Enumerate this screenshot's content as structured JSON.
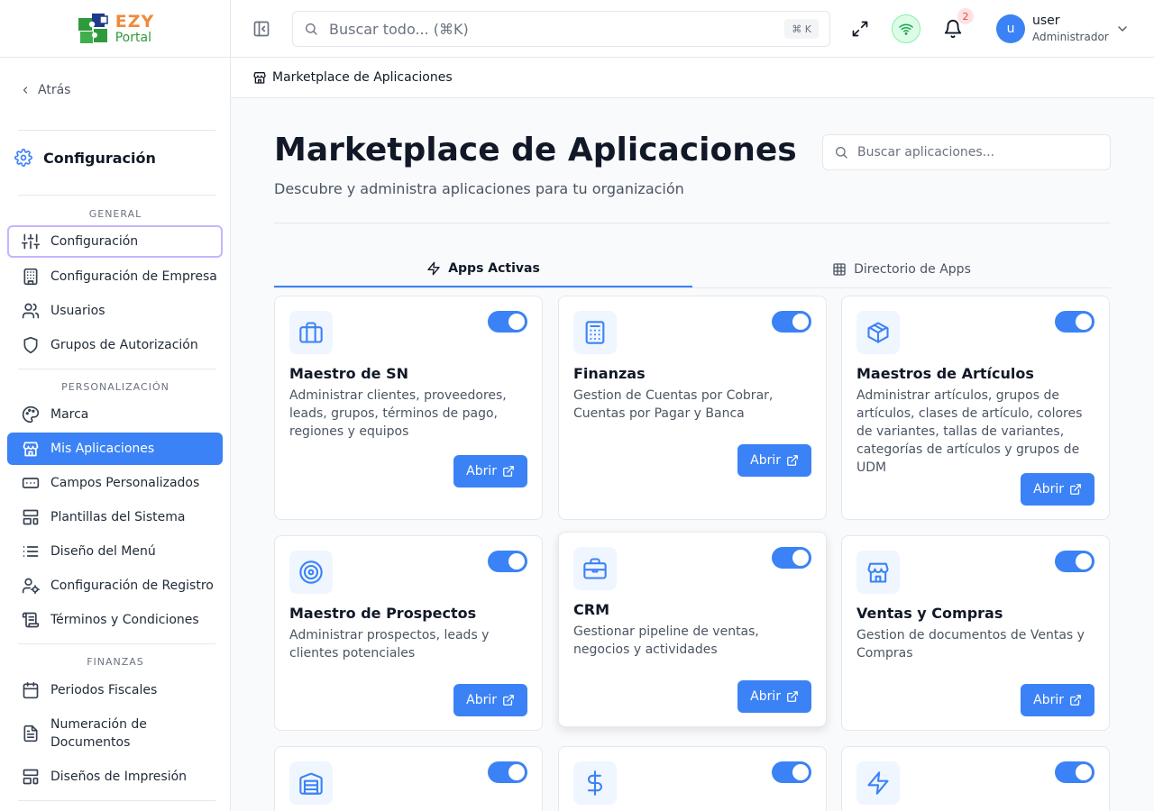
{
  "brand": {
    "line1": "EZY",
    "line2": "Portal"
  },
  "sidebar": {
    "back_label": "Atrás",
    "section_title": "Configuración",
    "groups": {
      "general": "GENERAL",
      "personalizacion": "PERSONALIZACIÓN",
      "finanzas": "FINANZAS"
    },
    "items": [
      {
        "label": "Configuración",
        "icon": "sliders-icon"
      },
      {
        "label": "Configuración de Empresa",
        "icon": "building-icon"
      },
      {
        "label": "Usuarios",
        "icon": "users-icon"
      },
      {
        "label": "Grupos de Autorización",
        "icon": "shield-icon"
      },
      {
        "label": "Marca",
        "icon": "palette-icon"
      },
      {
        "label": "Mis Aplicaciones",
        "icon": "store-icon"
      },
      {
        "label": "Campos Personalizados",
        "icon": "form-field-icon"
      },
      {
        "label": "Plantillas del Sistema",
        "icon": "layout-template-icon"
      },
      {
        "label": "Diseño del Menú",
        "icon": "list-icon"
      },
      {
        "label": "Configuración de Registro",
        "icon": "user-cog-icon"
      },
      {
        "label": "Términos y Condiciones",
        "icon": "scroll-icon"
      },
      {
        "label": "Periodos Fiscales",
        "icon": "calendar-icon"
      },
      {
        "label": "Numeración de Documentos",
        "icon": "file-text-icon"
      },
      {
        "label": "Diseños de Impresión",
        "icon": "layout-template-icon"
      }
    ]
  },
  "topbar": {
    "search_placeholder": "Buscar todo... (⌘K)",
    "shortcut": "⌘ K",
    "notifications_count": "2",
    "user_initial": "u",
    "user_name": "user",
    "user_role": "Administrador"
  },
  "breadcrumb": {
    "label": "Marketplace de Aplicaciones"
  },
  "main": {
    "title": "Marketplace de Aplicaciones",
    "subtitle": "Descubre y administra aplicaciones para tu organización",
    "search_placeholder": "Buscar aplicaciones...",
    "tabs": [
      {
        "label": "Apps Activas",
        "icon": "zap-icon"
      },
      {
        "label": "Directorio de Apps",
        "icon": "grid-icon"
      }
    ],
    "open_label": "Abrir",
    "apps": [
      {
        "title": "Maestro de SN",
        "desc": "Administrar clientes, proveedores, leads, grupos, términos de pago, regiones y equipos",
        "icon": "briefcase-icon",
        "enabled": true
      },
      {
        "title": "Finanzas",
        "desc": "Gestion de Cuentas por Cobrar, Cuentas por Pagar y Banca",
        "icon": "calculator-icon",
        "enabled": true
      },
      {
        "title": "Maestros de Artículos",
        "desc": "Administrar artículos, grupos de artículos, clases de artículo, colores de variantes, tallas de variantes, categorías de artículos y grupos de UDM",
        "icon": "package-icon",
        "enabled": true
      },
      {
        "title": "Maestro de Prospectos",
        "desc": "Administrar prospectos, leads y clientes potenciales",
        "icon": "target-icon",
        "enabled": true
      },
      {
        "title": "CRM",
        "desc": "Gestionar pipeline de ventas, negocios y actividades",
        "icon": "briefcase-icon",
        "enabled": true
      },
      {
        "title": "Ventas y Compras",
        "desc": "Gestion de documentos de Ventas y Compras",
        "icon": "store-icon",
        "enabled": true
      },
      {
        "title": "",
        "desc": "",
        "icon": "warehouse-icon",
        "enabled": true
      },
      {
        "title": "",
        "desc": "",
        "icon": "dollar-icon",
        "enabled": true
      },
      {
        "title": "",
        "desc": "",
        "icon": "zap-icon",
        "enabled": true
      }
    ]
  }
}
